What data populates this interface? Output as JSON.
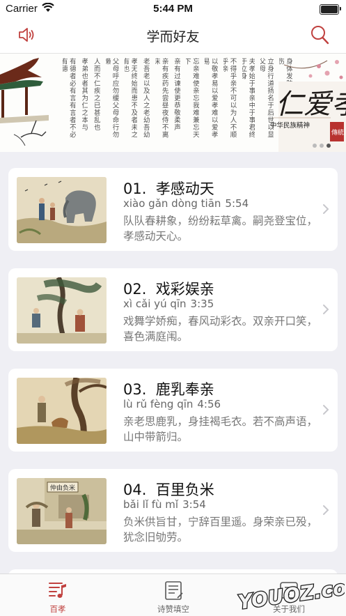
{
  "status_bar": {
    "carrier": "Carrier",
    "time": "5:44 PM",
    "battery_level": 1.0
  },
  "nav": {
    "title": "学而好友",
    "left_icon": "speaker-icon",
    "right_icon": "search-icon",
    "accent_color": "#c0413f"
  },
  "banner": {
    "columns": [
      "身体发肤受之父母不敢毁伤",
      "立身行道扬名于后世以显父母",
      "夫孝始于事亲中于事君终于立身",
      "不得乎亲不可以为人不顺乎亲",
      "以敬孝易以爱孝难以爱孝易",
      "忘亲难使亲忘我难兼忘天下",
      "亲有过谏使更恭敬柔声",
      "亲有疾药先尝昼夜侍不离床",
      "老吾老以及人之老幼吾幼",
      "孝无终始而患不及者未之有也",
      "父母呼应勿缓父母命行勿懒",
      "人而不仁疾之已甚乱也",
      "孝弟也者其为仁之本与",
      "有德者必有言有言者不必有德"
    ],
    "calligraphy": "仁爱孝",
    "subtitle": "中华民族精神",
    "seal": "傳統",
    "dots_count": 3
  },
  "lessons": [
    {
      "number": "01.",
      "title": "孝感动天",
      "pinyin": "xiào gǎn dòng tiān",
      "duration": "5:54",
      "text": "队队春耕象，纷纷耘草禽。嗣尧登宝位，孝感动天心。"
    },
    {
      "number": "02.",
      "title": "戏彩娱亲",
      "pinyin": "xì cǎi yú qīn",
      "duration": "3:35",
      "text": "戏舞学娇痴，春风动彩衣。双亲开口笑，喜色满庭闱。"
    },
    {
      "number": "03.",
      "title": "鹿乳奉亲",
      "pinyin": "lù rǔ fèng qīn",
      "duration": "4:56",
      "text": "亲老思鹿乳，身挂褐毛衣。若不高声语，山中带箭归。"
    },
    {
      "number": "04.",
      "title": "百里负米",
      "pinyin": "bǎi lǐ fù mǐ",
      "duration": "3:54",
      "text": "负米供旨甘，宁辞百里遥。身荣亲已殁，犹念旧劬劳。"
    }
  ],
  "thumb_captions": {
    "t4": "仲由负米"
  },
  "tabs": [
    {
      "label": "百孝",
      "icon": "book-music-icon",
      "active": true
    },
    {
      "label": "诗赞填空",
      "icon": "notepad-icon",
      "active": false
    },
    {
      "label": "关于我们",
      "icon": "info-icon",
      "active": false
    }
  ],
  "watermark": "YOUOZ.com"
}
